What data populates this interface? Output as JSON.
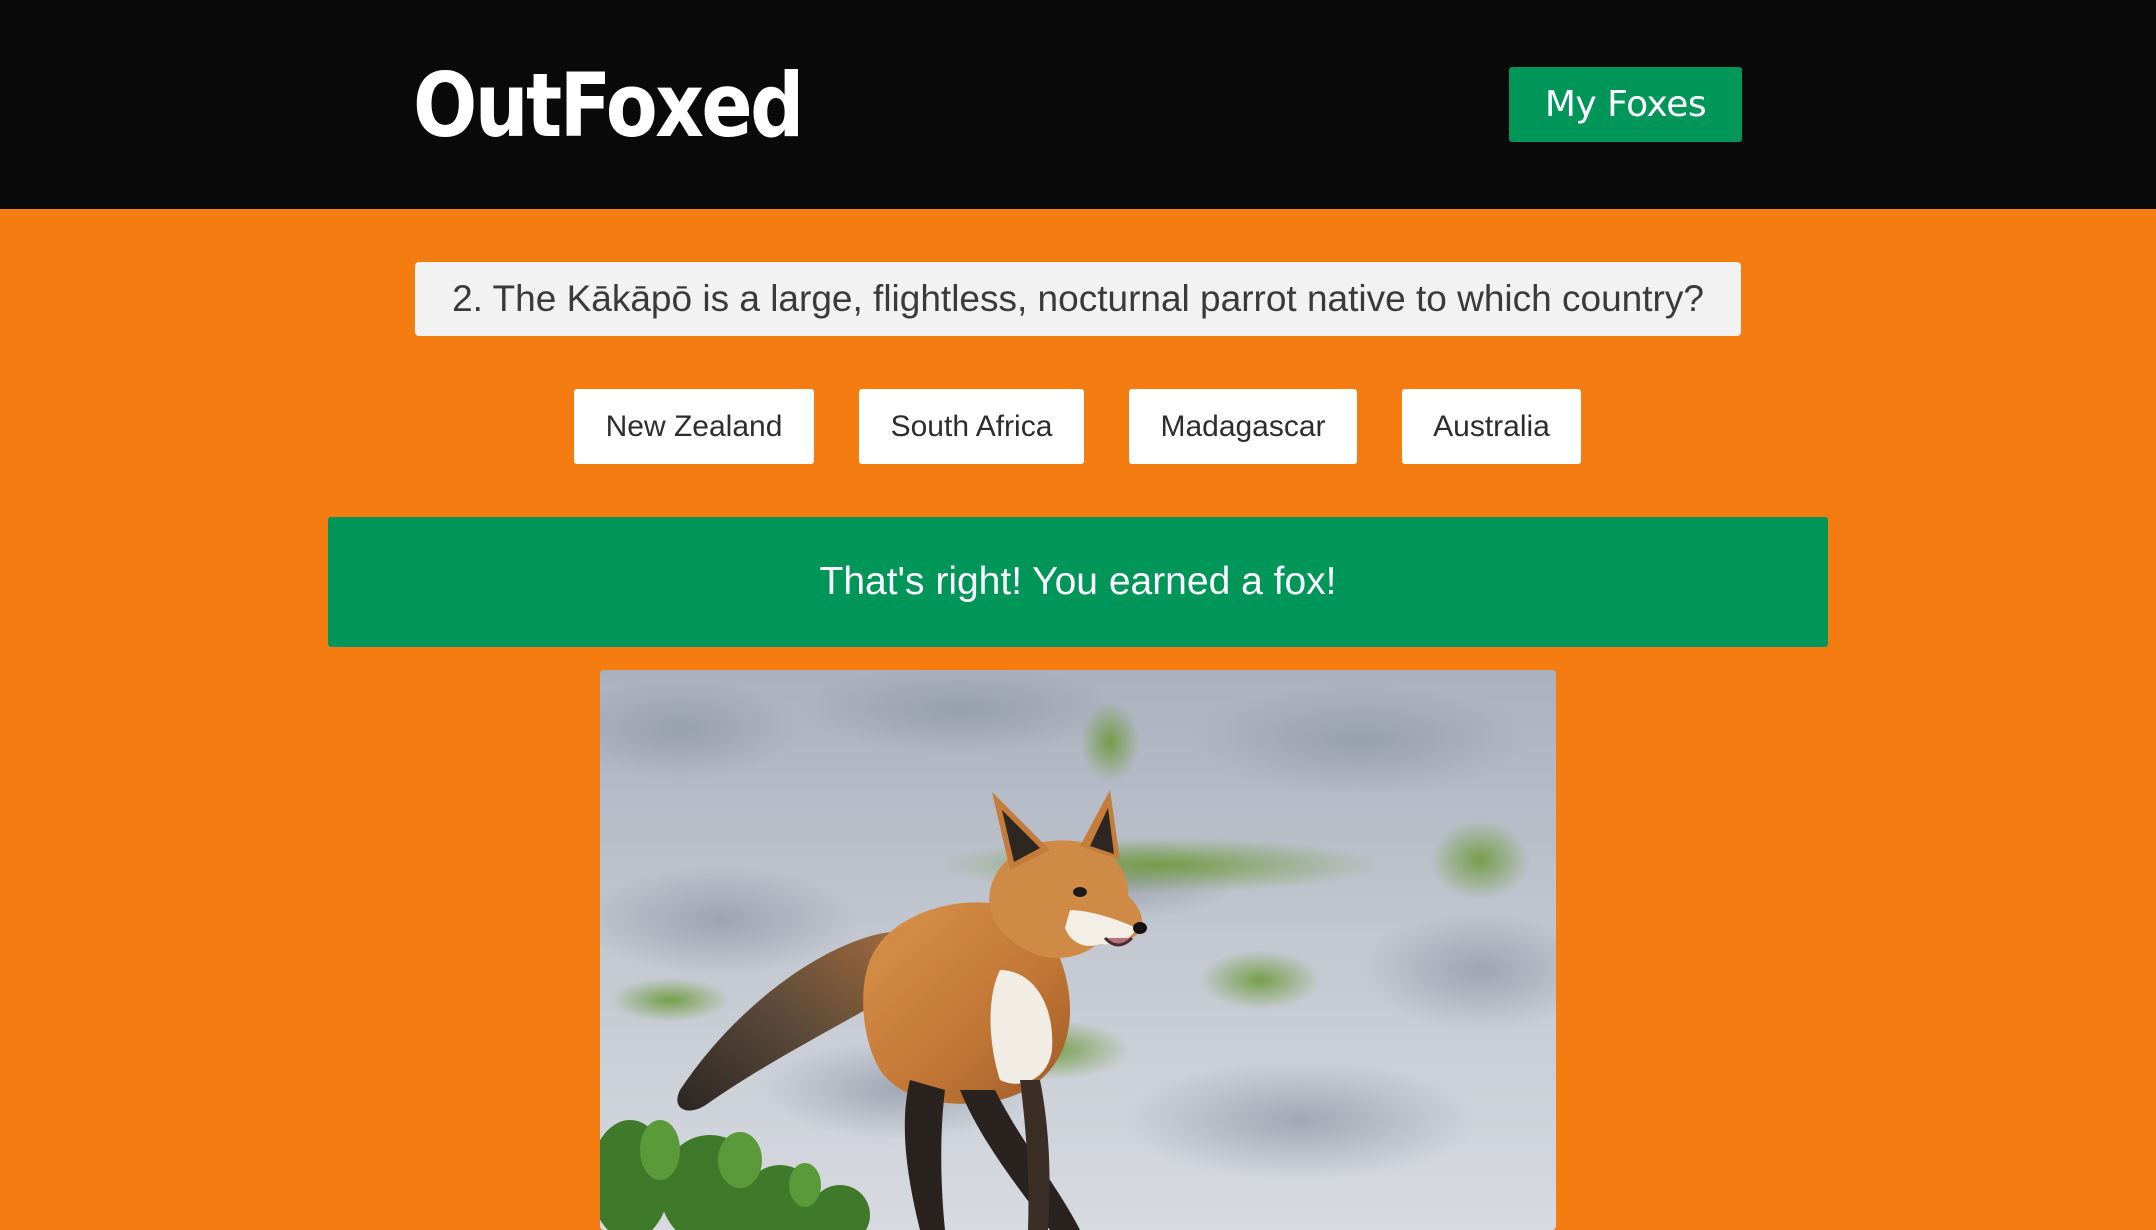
{
  "header": {
    "logo": "OutFoxed",
    "my_foxes_label": "My Foxes"
  },
  "quiz": {
    "question": "2. The Kākāpō is a large, flightless, nocturnal parrot native to which country?",
    "answers": [
      {
        "label": "New Zealand"
      },
      {
        "label": "South Africa"
      },
      {
        "label": "Madagascar"
      },
      {
        "label": "Australia"
      }
    ],
    "feedback": "That's right! You earned a fox!"
  },
  "colors": {
    "page_background": "#f57c10",
    "header_background": "#0a0a0a",
    "accent_green": "#00965a",
    "question_background": "#f2f2f2",
    "answer_background": "#ffffff"
  },
  "reward_image": {
    "subject": "red fox on sand"
  }
}
